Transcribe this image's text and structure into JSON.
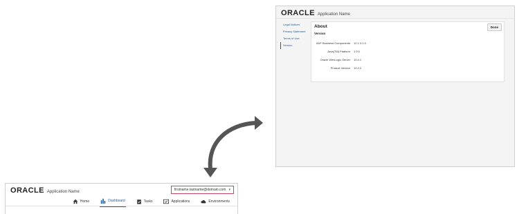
{
  "main_window": {
    "logo": "ORACLE",
    "app_name": "Application Name",
    "user_menu": {
      "label": "firstname.lastname@domain.com",
      "caret": "▾"
    },
    "nav": [
      {
        "label": "Home",
        "icon": "home-icon"
      },
      {
        "label": "Dashboard",
        "icon": "bar-chart-icon",
        "active": true
      },
      {
        "label": "Tasks",
        "icon": "clipboard-check-icon"
      },
      {
        "label": "Applications",
        "icon": "app-window-check-icon"
      },
      {
        "label": "Environments",
        "icon": "cloud-icon"
      }
    ]
  },
  "about_window": {
    "logo": "ORACLE",
    "app_name": "Application Name",
    "sidebar": [
      {
        "label": "Legal Notices"
      },
      {
        "label": "Privacy Statement"
      },
      {
        "label": "Terms of Use"
      },
      {
        "label": "Version",
        "active": true
      }
    ],
    "panel": {
      "title": "About",
      "subtitle": "Version",
      "done_label": "Done",
      "properties": [
        {
          "label": "ADF Business Components",
          "value": "12.1.3.1.0"
        },
        {
          "label": "Java(TM) Platform",
          "value": "1.9.0"
        },
        {
          "label": "Oracle WebLogic Server",
          "value": "10.4.1"
        },
        {
          "label": "Product Version",
          "value": "12.2.2"
        }
      ]
    }
  },
  "colors": {
    "accent": "#1a5fa8",
    "user_menu_border": "#c74660",
    "arrow": "#555555"
  }
}
